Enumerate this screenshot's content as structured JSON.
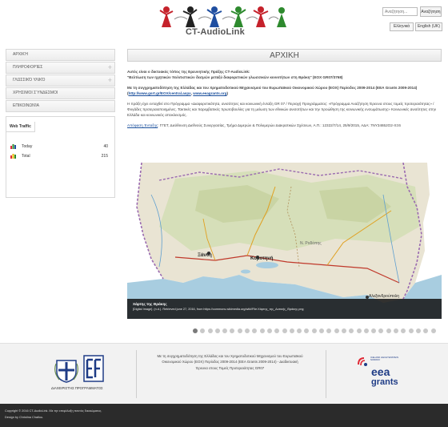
{
  "header": {
    "logo_text": "CT-AudioLink",
    "search_placeholder": "Αναζήτηση...",
    "search_button": "Αναζήτηση",
    "lang_gr": "Ελληνικά",
    "lang_en": "English (UK)"
  },
  "sidebar": {
    "items": [
      {
        "label": "Αρχική",
        "has_children": false
      },
      {
        "label": "Πληροφορίες",
        "has_children": true
      },
      {
        "label": "Γλωσσικό υλικό",
        "has_children": true
      },
      {
        "label": "Χρήσιμοι σύνδεσμοι",
        "has_children": false
      },
      {
        "label": "Επικοινωνία",
        "has_children": false
      }
    ],
    "web_traffic": {
      "title": "Web Traffic",
      "today_label": "Today",
      "today_value": "40",
      "total_label": "Total",
      "total_value": "215"
    }
  },
  "main": {
    "title": "ΑΡΧΙΚΗ",
    "p1_line1": "Αυτός είναι ο δικτυακός τόπος της Ερευνητικής Πράξης CT-AudioLink:",
    "p1_line2": "\"Βελτίωση των ηχητικών πολιτιστικών δεσμών μεταξύ διαφορετικών γλωσσικών κοινοτήτων στη Θράκη\" (ΕΟΧ GR07/3768)",
    "p2_text": "Με τη συγχρηματοδότηση της Ελλάδας και του Χρηματοδοτικού Μηχανισμού του Ευρωπαϊκού Οικονομικού Χώρου (ΕΟΧ) Περίοδος 2009-2014 (ΕΕΑ Grants 2009-2014) (",
    "p2_link1": "http://www.gsrt.gr/EOX/central.aspx",
    "p2_sep": ", ",
    "p2_link2": "www.eeagrants.org",
    "p2_end": ")",
    "p3_text": "Η πράξη έχει ενταχθεί στο Πρόγραμμα «Διαφορετικότητα, ανισότητες και κοινωνική ένταξη GR 07 / Περιοχή Προγράμματος: «Πρόγραμμα Αναζήτηση Έρευνα στους τομείς προτεραιότητας» / Φυγάδες προτεραιοποιημένες. Τακτικές και παρεμβατικές πρωτοβουλίες για τη μείωση των εθνικών ανισοτήτων και την προώθηση της κοινωνικής ενσωμάτωσης» Κοινωνικές ανισότητες στην Ελλάδα και κοινωνικός αποκλεισμός.",
    "p4_prefix": "Απόφαση Ένταξης",
    "p4_text": ": ΓΓΕΤ, Διεύθυνση Διεθνούς Συνεργασίας, Τμήμα Διμερών & Πολυμερών Διακρατικών Σχέσεων, Α.Π.: 12322/7/14, 25/9/2015, ΑΔΑ: 7ΝΥ34652Ο2-ΧΞ6"
  },
  "slider": {
    "caption_title": "Χάρτης της Θράκης",
    "caption_sub": "[Digital Image]. (n.d.). Retrieved june 27, 2016, from https://commons.wikimedia.org/wiki/File:Χάρτης_της_Δυτικής_Θράκης.png",
    "map_labels": {
      "xanthi": "Ξάνθη",
      "komotini": "Κομοτηνή",
      "rodopi": "Ν. Ροδόπης",
      "alexandroupoli": "Αλεξανδρούπολη"
    },
    "dot_count": 33,
    "active_dot": 0
  },
  "footer": {
    "management_label": "Διαχειριστής προγράμματος",
    "funding_text": "Με τη συγχρηματοδότηση της Ελλάδας και του Χρηματοδοτικού Μηχανισμού του Ευρωπαϊκού Οικονομικού Χώρου (ΕΟΧ) Περίοδος 2009-2014 (EEA Grants 2009-2014) - Διαδικτυακή Έρευνα στους Τομείς Προτεραιότητας GR07",
    "eea_top": "ICELAND LIECHTENSTEIN NORWAY",
    "eea_main": "eea",
    "eea_sub": "grants"
  },
  "bottom_bar": {
    "copyright": "Copyright © 2016 CT-AudioLink. Με την επιφύλαξη παντός δικαιώματος.",
    "design": "Design by Christina Chatlou."
  },
  "colors": {
    "link": "#1a4f9c",
    "bottom_bar": "#2b2b2b",
    "eea_red": "#e02a36",
    "eea_blue": "#1f3c86"
  }
}
